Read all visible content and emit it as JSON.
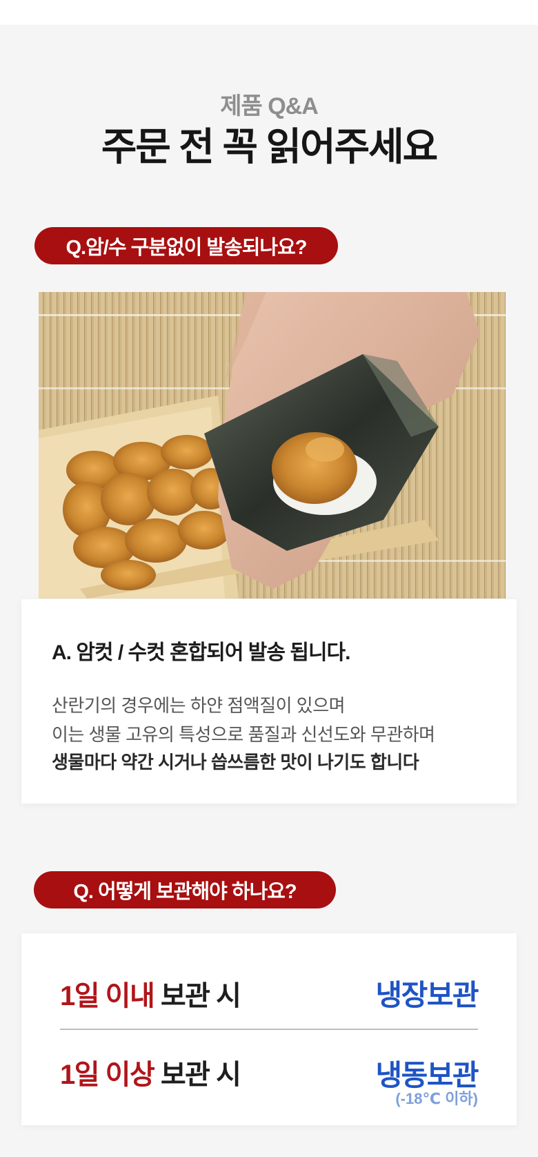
{
  "header": {
    "eyebrow": "제품 Q&A",
    "title": "주문 전 꼭 읽어주세요"
  },
  "qa1": {
    "question": "Q.암/수 구분없이 발송되나요?",
    "answer_title": "A. 암컷 / 수컷 혼합되어 발송 됩니다.",
    "lines": [
      "산란기의 경우에는 하얀 점액질이 있으며",
      "이는 생물 고유의 특성으로 품질과 신선도와 무관하며",
      "생물마다 약간 시거나 씁쓰름한 맛이 나기도 합니다"
    ]
  },
  "qa2": {
    "question": "Q. 어떻게 보관해야 하나요?",
    "rows": [
      {
        "highlight": "1일 이내",
        "rest": " 보관 시",
        "value": "냉장보관"
      },
      {
        "highlight": "1일 이상",
        "rest": " 보관 시",
        "value": "냉동보관",
        "note": "(-18℃ 이하)"
      }
    ]
  },
  "colors": {
    "accent_red": "#a80f10",
    "value_blue": "#1e54c4",
    "note_blue": "#7d9fdc"
  }
}
